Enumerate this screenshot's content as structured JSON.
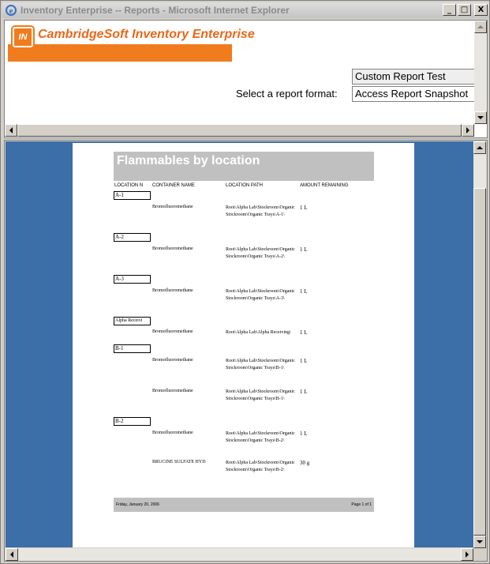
{
  "window": {
    "title": "Inventory Enterprise -- Reports - Microsoft Internet Explorer",
    "minimize_glyph": "_",
    "maximize_glyph": "□",
    "close_glyph": "X"
  },
  "header": {
    "logo_mark": "IN",
    "logo_text": "CambridgeSoft Inventory Enterprise",
    "report_name": "Custom Report Test",
    "format_label": "Select a report format:",
    "format_value": "Access Report Snapshot"
  },
  "report": {
    "title": "Flammables by location",
    "columns": [
      "LOCATION N",
      "CONTAINER NAME",
      "LOCATION PATH",
      "AMOUNT REMAINING"
    ],
    "groups": [
      {
        "location": "A-1",
        "rows": [
          {
            "container": "Bromofluoromethane",
            "path": "Root\\Alpha Lab\\Stockroom\\Organic Stockroom\\Organic Trays\\A-1\\",
            "amount": "1 L"
          }
        ]
      },
      {
        "location": "A-2",
        "rows": [
          {
            "container": "Bromofluoromethane",
            "path": "Root\\Alpha Lab\\Stockroom\\Organic Stockroom\\Organic Trays\\A-2\\",
            "amount": "1 L"
          }
        ]
      },
      {
        "location": "A-3",
        "rows": [
          {
            "container": "Bromofluoromethane",
            "path": "Root\\Alpha Lab\\Stockroom\\Organic Stockroom\\Organic Trays\\A-3\\",
            "amount": "1 L"
          }
        ]
      },
      {
        "location": "Alpha Receivi",
        "rows": [
          {
            "container": "Bromofluoromethane",
            "path": "Root\\Alpha Lab\\Alpha Receiving\\",
            "amount": "1 L"
          }
        ]
      },
      {
        "location": "B-1",
        "rows": [
          {
            "container": "Bromofluoromethane",
            "path": "Root\\Alpha Lab\\Stockroom\\Organic Stockroom\\Organic Trays\\B-1\\",
            "amount": "1 L"
          },
          {
            "container": "Bromofluoromethane",
            "path": "Root\\Alpha Lab\\Stockroom\\Organic Stockroom\\Organic Trays\\B-1\\",
            "amount": "1 L"
          }
        ]
      },
      {
        "location": "B-2",
        "rows": [
          {
            "container": "Bromofluoromethane",
            "path": "Root\\Alpha Lab\\Stockroom\\Organic Stockroom\\Organic Trays\\B-2\\",
            "amount": "1 L"
          },
          {
            "container": "BRUCINE SULFATE HYD",
            "path": "Root\\Alpha Lab\\Stockroom\\Organic Stockroom\\Organic Trays\\B-2\\",
            "amount": "30 g"
          }
        ]
      }
    ],
    "footer_date": "Friday, January 20, 2006",
    "footer_page": "Page 1 of 1"
  },
  "colors": {
    "brand_orange": "#f07c1e",
    "viewer_blue": "#3c6ea8",
    "report_band": "#c0c0c0"
  },
  "icons": [
    "ie-logo-icon",
    "scroll-up-icon",
    "scroll-down-icon",
    "scroll-left-icon",
    "scroll-right-icon"
  ]
}
